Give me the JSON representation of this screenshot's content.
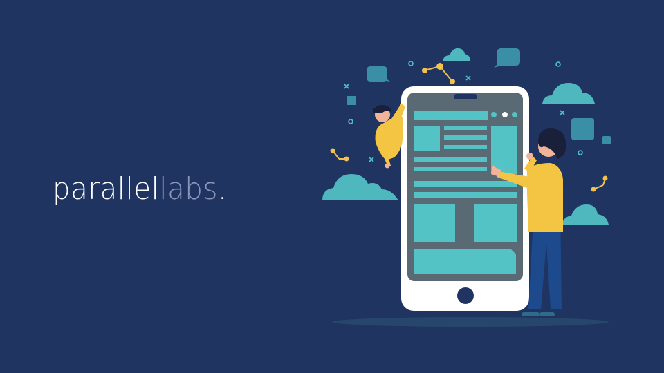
{
  "brand": {
    "part1": "parallel",
    "part2": "labs",
    "period": "."
  },
  "colors": {
    "background": "#1f3461",
    "teal": "#53c3c6",
    "teal_cloud": "#4fb8be",
    "phone_body": "#ffffff",
    "phone_screen": "#5a6a74",
    "shirt_yellow": "#f4c542",
    "pants_blue": "#1d4a8c",
    "accent_gold": "#f2c14e",
    "brand_muted": "#8c96b8"
  },
  "icons": [
    "cloud-icon",
    "chat-bubble-icon",
    "node-connector-icon",
    "x-mark-icon",
    "circle-mark-icon"
  ]
}
